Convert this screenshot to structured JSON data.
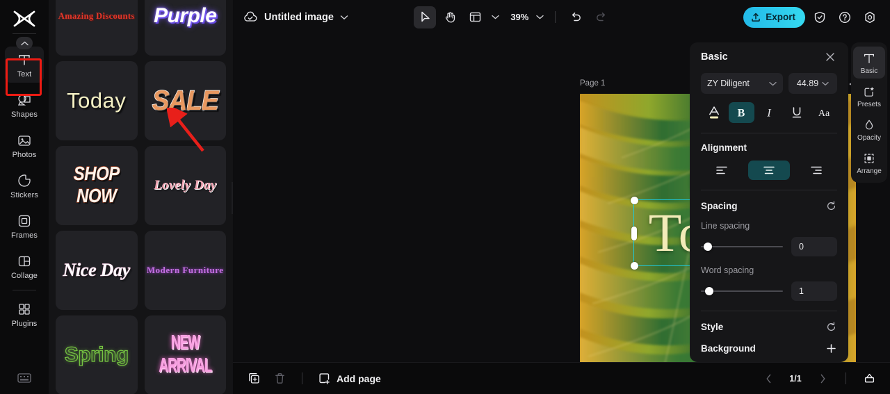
{
  "app": {
    "logo_icon": "capcut-logo-icon"
  },
  "left_rail": {
    "collapse_icon": "chevron-up-icon",
    "items": [
      {
        "label": "Text",
        "icon": "text-t-icon",
        "active": true
      },
      {
        "label": "Shapes",
        "icon": "shapes-icon",
        "active": false
      },
      {
        "label": "Photos",
        "icon": "photo-icon",
        "active": false
      },
      {
        "label": "Stickers",
        "icon": "sticker-icon",
        "active": false
      },
      {
        "label": "Frames",
        "icon": "frame-icon",
        "active": false
      },
      {
        "label": "Collage",
        "icon": "collage-icon",
        "active": false
      },
      {
        "label": "Plugins",
        "icon": "plugins-grid-icon",
        "active": false
      }
    ],
    "bottom_icon": "keyboard-shortcuts-icon"
  },
  "template_panel": {
    "collapse_icon": "chevron-left-icon",
    "templates": [
      {
        "label": "Amazing Discounts",
        "style": "t-amazing"
      },
      {
        "label": "Purple",
        "style": "t-purple"
      },
      {
        "label": "Today",
        "style": "t-today"
      },
      {
        "label": "SALE",
        "style": "t-sale"
      },
      {
        "label": "SHOP NOW",
        "style": "t-shopnow"
      },
      {
        "label": "Lovely Day",
        "style": "t-lovely"
      },
      {
        "label": "Nice Day",
        "style": "t-niceday"
      },
      {
        "label": "Modern Furniture",
        "style": "t-modern"
      },
      {
        "label": "Spring",
        "style": "t-spring"
      },
      {
        "label": "NEW ARRIVAL",
        "style": "t-newarrival"
      }
    ]
  },
  "topbar": {
    "cloud_icon": "cloud-saved-icon",
    "title": "Untitled image",
    "title_chevron_icon": "chevron-down-icon",
    "select_tool_icon": "cursor-arrow-icon",
    "hand_tool_icon": "hand-icon",
    "layout_tool_icon": "layout-panel-icon",
    "layout_chevron_icon": "chevron-down-icon",
    "zoom_value": "39%",
    "zoom_chevron_icon": "chevron-down-icon",
    "undo_icon": "undo-icon",
    "redo_icon": "redo-icon",
    "export_label": "Export",
    "export_icon": "upload-icon",
    "export_color": "#2ec8e6",
    "shield_icon": "shield-check-icon",
    "help_icon": "question-circle-icon",
    "settings_icon": "gear-icon"
  },
  "canvas": {
    "page_label": "Page 1",
    "duplicate_icon": "duplicate-page-icon",
    "more_icon": "more-dots-icon",
    "selected_text": "Today",
    "float_duplicate_icon": "duplicate-icon",
    "float_more_icon": "more-dots-icon",
    "rotate_icon": "rotate-handle-icon",
    "selection_color": "#1fc8d8",
    "text_color": "#f2ebb8"
  },
  "properties": {
    "title": "Basic",
    "close_icon": "close-x-icon",
    "font_family": "ZY Diligent",
    "font_family_chevron_icon": "chevron-down-icon",
    "font_size": "44.89",
    "font_size_chevron_icon": "chevron-down-icon",
    "text_color_swatch": "#f2ebb8",
    "buttons": [
      {
        "name": "font-color",
        "glyph": "A",
        "active": false
      },
      {
        "name": "bold",
        "glyph": "B",
        "active": true
      },
      {
        "name": "italic",
        "glyph": "I",
        "active": false
      },
      {
        "name": "underline",
        "glyph": "U",
        "active": false
      },
      {
        "name": "text-case",
        "glyph": "Aa",
        "active": false
      }
    ],
    "alignment_title": "Alignment",
    "alignment": [
      {
        "name": "align-left",
        "active": false
      },
      {
        "name": "align-center",
        "active": true
      },
      {
        "name": "align-right",
        "active": false
      }
    ],
    "spacing_title": "Spacing",
    "spacing_reset_icon": "reset-icon",
    "line_spacing_label": "Line spacing",
    "line_spacing_value": "0",
    "word_spacing_label": "Word spacing",
    "word_spacing_value": "1",
    "style_title": "Style",
    "style_reset_icon": "reset-icon",
    "background_title": "Background",
    "background_add_icon": "plus-icon"
  },
  "right_rail": {
    "items": [
      {
        "label": "Basic",
        "icon": "text-t-icon",
        "active": true
      },
      {
        "label": "Presets",
        "icon": "presets-star-icon",
        "active": false
      },
      {
        "label": "Opacity",
        "icon": "opacity-drop-icon",
        "active": false
      },
      {
        "label": "Arrange",
        "icon": "arrange-icon",
        "active": false
      }
    ]
  },
  "bottombar": {
    "duplicate_icon": "duplicate-page-icon",
    "delete_icon": "trash-icon",
    "add_page_label": "Add page",
    "add_page_icon": "add-page-icon",
    "prev_icon": "chevron-left-icon",
    "page_indicator": "1/1",
    "next_icon": "chevron-right-icon",
    "present_icon": "present-icon"
  },
  "annotation": {
    "highlight_color": "#ee1b13",
    "arrow_color": "#e81f1a"
  }
}
